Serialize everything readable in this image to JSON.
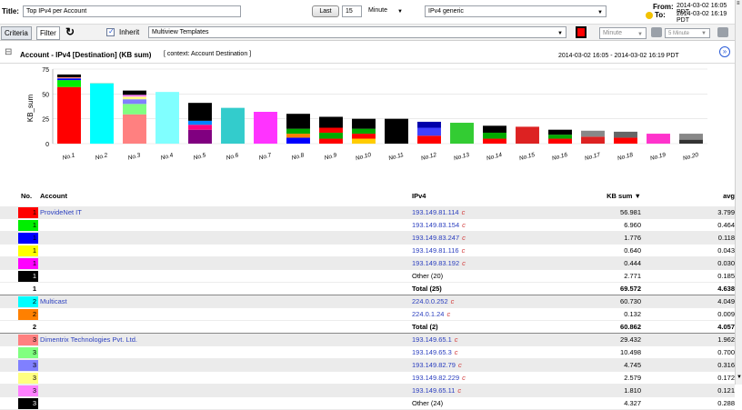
{
  "header": {
    "title_label": "Title:",
    "title_value": "Top IPv4 per Account",
    "last_label": "Last",
    "last_value": "15",
    "unit_value": "Minute",
    "template_value": "IPv4 generic",
    "from_label": "From:",
    "from_value": "2014-03-02 16:05 PDT",
    "to_label": "To:",
    "to_value": "2014-03-02 16:19 PDT"
  },
  "toolbar": {
    "tab_criteria": "Criteria",
    "tab_filter": "Filter",
    "inherit_label": "Inherit",
    "multiview_value": "Multiview Templates",
    "granularity_value": "Minute",
    "interval_value": "5 Minute"
  },
  "section": {
    "title": "Account - IPv4 [Destination]  (KB sum)",
    "context": "[ context: Account Destination ]",
    "range": "2014-03-02 16:05  - 2014-03-02 16:19 PDT"
  },
  "chart_data": {
    "type": "bar",
    "stacked": true,
    "ylabel": "KB_sum",
    "ylim": [
      0,
      75
    ],
    "yticks": [
      0,
      25,
      50,
      75
    ],
    "grid": true,
    "categories": [
      "No.1",
      "No.2",
      "No.3",
      "No.4",
      "No.5",
      "No.6",
      "No.7",
      "No.8",
      "No.9",
      "No.10",
      "No.11",
      "No.12",
      "No.13",
      "No.14",
      "No.15",
      "No.16",
      "No.17",
      "No.18",
      "No.19",
      "No.20"
    ],
    "stacks": [
      [
        {
          "v": 56.981,
          "c": "#ff0000"
        },
        {
          "v": 6.96,
          "c": "#00ee00"
        },
        {
          "v": 1.776,
          "c": "#0000ff"
        },
        {
          "v": 0.64,
          "c": "#ffff00"
        },
        {
          "v": 0.444,
          "c": "#ff00ff"
        },
        {
          "v": 2.771,
          "c": "#000000"
        }
      ],
      [
        {
          "v": 60.73,
          "c": "#00ffff"
        },
        {
          "v": 0.132,
          "c": "#ff8000"
        }
      ],
      [
        {
          "v": 29.432,
          "c": "#ff8080"
        },
        {
          "v": 10.498,
          "c": "#80ff80"
        },
        {
          "v": 4.745,
          "c": "#8080ff"
        },
        {
          "v": 2.579,
          "c": "#ffff80"
        },
        {
          "v": 1.81,
          "c": "#ff80ff"
        },
        {
          "v": 4.327,
          "c": "#000000"
        }
      ],
      [
        {
          "v": 52,
          "c": "#80ffff"
        }
      ],
      [
        {
          "v": 14,
          "c": "#800080"
        },
        {
          "v": 5,
          "c": "#ff0080"
        },
        {
          "v": 4,
          "c": "#0080ff"
        },
        {
          "v": 18,
          "c": "#000000"
        }
      ],
      [
        {
          "v": 36,
          "c": "#33cccc"
        }
      ],
      [
        {
          "v": 32,
          "c": "#ff33ff"
        }
      ],
      [
        {
          "v": 6,
          "c": "#0000ff"
        },
        {
          "v": 4,
          "c": "#ff8000"
        },
        {
          "v": 5,
          "c": "#00aa00"
        },
        {
          "v": 15,
          "c": "#000000"
        }
      ],
      [
        {
          "v": 5,
          "c": "#ff0000"
        },
        {
          "v": 6,
          "c": "#00aa00"
        },
        {
          "v": 5,
          "c": "#ff0000"
        },
        {
          "v": 11,
          "c": "#000000"
        }
      ],
      [
        {
          "v": 5,
          "c": "#ffcc00"
        },
        {
          "v": 5,
          "c": "#ff0000"
        },
        {
          "v": 5,
          "c": "#00aa00"
        },
        {
          "v": 10,
          "c": "#000000"
        }
      ],
      [
        {
          "v": 25,
          "c": "#000000"
        }
      ],
      [
        {
          "v": 8,
          "c": "#ff0000"
        },
        {
          "v": 8,
          "c": "#4040ff"
        },
        {
          "v": 6,
          "c": "#0000aa"
        }
      ],
      [
        {
          "v": 21,
          "c": "#33cc33"
        }
      ],
      [
        {
          "v": 5,
          "c": "#ff0000"
        },
        {
          "v": 6,
          "c": "#00aa00"
        },
        {
          "v": 7,
          "c": "#000000"
        }
      ],
      [
        {
          "v": 17,
          "c": "#dd2222"
        }
      ],
      [
        {
          "v": 5,
          "c": "#ff0000"
        },
        {
          "v": 4,
          "c": "#00aa00"
        },
        {
          "v": 5,
          "c": "#000000"
        }
      ],
      [
        {
          "v": 7,
          "c": "#dd2222"
        },
        {
          "v": 6,
          "c": "#888888"
        }
      ],
      [
        {
          "v": 6,
          "c": "#ff0000"
        },
        {
          "v": 6,
          "c": "#666666"
        }
      ],
      [
        {
          "v": 10,
          "c": "#ff33cc"
        }
      ],
      [
        {
          "v": 4,
          "c": "#333333"
        },
        {
          "v": 6,
          "c": "#888888"
        }
      ]
    ]
  },
  "table": {
    "headers": {
      "no": "No.",
      "account": "Account",
      "ipv4": "IPv4",
      "kb": "KB sum ▼",
      "avg": "avg"
    },
    "rows": [
      {
        "no": "1",
        "account": "ProvideNet IT",
        "ipv4": "193.149.81.114",
        "kb": "56.981",
        "avg": "3.799",
        "color": "#ff0000",
        "alt": true
      },
      {
        "no": "1",
        "account": "",
        "ipv4": "193.149.83.154",
        "kb": "6.960",
        "avg": "0.464",
        "color": "#00ee00"
      },
      {
        "no": "1",
        "account": "",
        "ipv4": "193.149.83.247",
        "kb": "1.776",
        "avg": "0.118",
        "color": "#0000ff",
        "alt": true
      },
      {
        "no": "1",
        "account": "",
        "ipv4": "193.149.81.116",
        "kb": "0.640",
        "avg": "0.043",
        "color": "#ffff00"
      },
      {
        "no": "1",
        "account": "",
        "ipv4": "193.149.83.192",
        "kb": "0.444",
        "avg": "0.030",
        "color": "#ff00ff",
        "alt": true
      },
      {
        "no": "1",
        "account": "",
        "ipv4": "Other (20)",
        "kb": "2.771",
        "avg": "0.185",
        "color": "#000000",
        "plain": true
      },
      {
        "no": "1",
        "account": "",
        "ipv4": "Total (25)",
        "kb": "69.572",
        "avg": "4.638",
        "total": true
      },
      {
        "no": "2",
        "account": "Multicast",
        "ipv4": "224.0.0.252",
        "kb": "60.730",
        "avg": "4.049",
        "color": "#00ffff",
        "alt": true
      },
      {
        "no": "2",
        "account": "",
        "ipv4": "224.0.1.24",
        "kb": "0.132",
        "avg": "0.009",
        "color": "#ff8000"
      },
      {
        "no": "2",
        "account": "",
        "ipv4": "Total (2)",
        "kb": "60.862",
        "avg": "4.057",
        "total": true
      },
      {
        "no": "3",
        "account": "Dimentrix Technologies Pvt. Ltd.",
        "ipv4": "193.149.65.1",
        "kb": "29.432",
        "avg": "1.962",
        "color": "#ff8080",
        "alt": true
      },
      {
        "no": "3",
        "account": "",
        "ipv4": "193.149.65.3",
        "kb": "10.498",
        "avg": "0.700",
        "color": "#80ff80"
      },
      {
        "no": "3",
        "account": "",
        "ipv4": "193.149.82.79",
        "kb": "4.745",
        "avg": "0.316",
        "color": "#8080ff",
        "alt": true
      },
      {
        "no": "3",
        "account": "",
        "ipv4": "193.149.82.229",
        "kb": "2.579",
        "avg": "0.172",
        "color": "#ffff80"
      },
      {
        "no": "3",
        "account": "",
        "ipv4": "193.149.65.11",
        "kb": "1.810",
        "avg": "0.121",
        "color": "#ff80ff",
        "alt": true
      },
      {
        "no": "3",
        "account": "",
        "ipv4": "Other (24)",
        "kb": "4.327",
        "avg": "0.288",
        "color": "#000000",
        "plain": true
      }
    ]
  },
  "icons": {
    "refresh": "↻",
    "expand": "⊟",
    "collapse": "»"
  }
}
